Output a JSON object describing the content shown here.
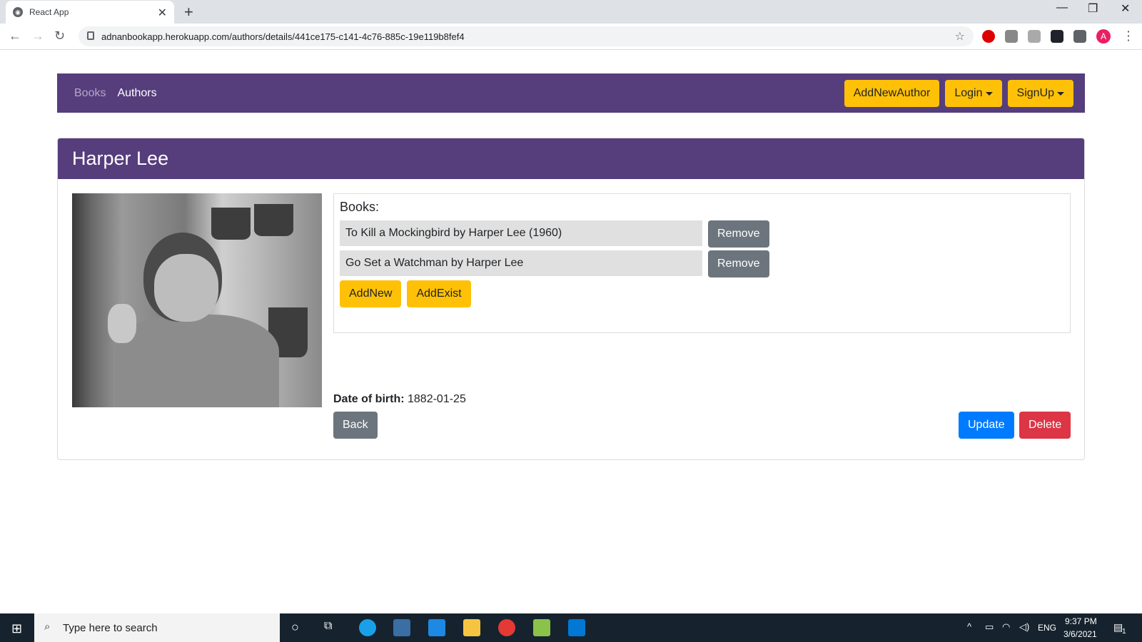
{
  "browser": {
    "tab_title": "React App",
    "url": "adnanbookapp.herokuapp.com/authors/details/441ce175-c141-4c76-885c-19e119b8fef4",
    "profile_letter": "A"
  },
  "navbar": {
    "books_link": "Books",
    "authors_link": "Authors",
    "add_new_author": "AddNewAuthor",
    "login": "Login",
    "signup": "SignUp"
  },
  "author": {
    "name": "Harper Lee",
    "books_heading": "Books:",
    "books": [
      {
        "title": "To Kill a Mockingbird by Harper Lee (1960)",
        "remove_label": "Remove"
      },
      {
        "title": "Go Set a Watchman by Harper Lee",
        "remove_label": "Remove"
      }
    ],
    "add_new_label": "AddNew",
    "add_exist_label": "AddExist",
    "dob_label": "Date of birth:",
    "dob_value": "1882-01-25",
    "back_label": "Back",
    "update_label": "Update",
    "delete_label": "Delete"
  },
  "taskbar": {
    "search_placeholder": "Type here to search",
    "lang": "ENG",
    "time": "9:37 PM",
    "date": "3/6/2021",
    "notif_count": "1"
  },
  "colors": {
    "navbar_bg": "#563d7c",
    "warning": "#ffc107",
    "primary": "#007bff",
    "danger": "#dc3545",
    "secondary": "#6c757d"
  }
}
